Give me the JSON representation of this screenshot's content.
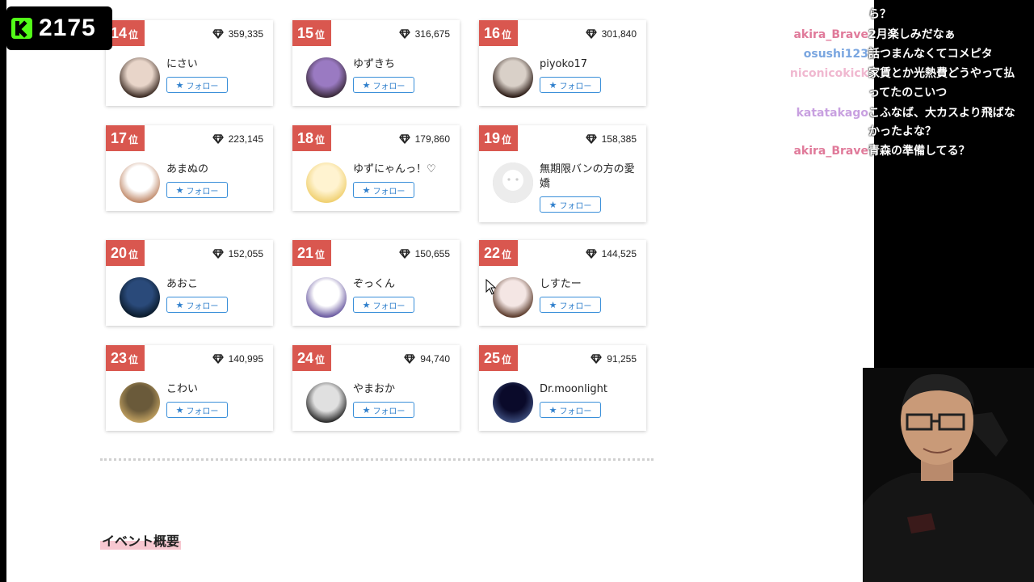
{
  "viewer_badge": {
    "count": "2175"
  },
  "ranking": {
    "rank_suffix": "位",
    "follow_label": "フォロー",
    "entries": [
      {
        "rank": "14",
        "points": "359,335",
        "name": "にさい"
      },
      {
        "rank": "15",
        "points": "316,675",
        "name": "ゆずきち"
      },
      {
        "rank": "16",
        "points": "301,840",
        "name": "piyoko17"
      },
      {
        "rank": "17",
        "points": "223,145",
        "name": "あまぬの"
      },
      {
        "rank": "18",
        "points": "179,860",
        "name": "ゆずにゃんっ！♡"
      },
      {
        "rank": "19",
        "points": "158,385",
        "name": "無期限バンの方の愛嬌"
      },
      {
        "rank": "20",
        "points": "152,055",
        "name": "あおこ"
      },
      {
        "rank": "21",
        "points": "150,655",
        "name": "ぞっくん"
      },
      {
        "rank": "22",
        "points": "144,525",
        "name": "しすたー"
      },
      {
        "rank": "23",
        "points": "140,995",
        "name": "こわい"
      },
      {
        "rank": "24",
        "points": "94,740",
        "name": "やまおか"
      },
      {
        "rank": "25",
        "points": "91,255",
        "name": "Dr.moonlight"
      }
    ]
  },
  "section": {
    "title": "イベント概要"
  },
  "chat": {
    "messages": [
      {
        "user": "",
        "text": "ら？",
        "color": "#9ad07a"
      },
      {
        "user": "akira_Brave",
        "text": "2月楽しみだなぁ",
        "color": "#e07a9a"
      },
      {
        "user": "osushi123",
        "text": "話つまんなくてコメピタ",
        "color": "#7aa6e0"
      },
      {
        "user": "niconicokick",
        "text": "家賃とか光熱費どうやって払",
        "color": "#f0b8d0"
      },
      {
        "user": "",
        "text": "ってたのこいつ",
        "color": "#f0b8d0"
      },
      {
        "user": "katatakago",
        "text": "こふなば、大カスより飛ばな",
        "color": "#c8a0e0"
      },
      {
        "user": "",
        "text": "かったよな？",
        "color": "#c8a0e0"
      },
      {
        "user": "akira_Brave",
        "text": "青森の準備してる？",
        "color": "#e07a9a"
      }
    ]
  }
}
